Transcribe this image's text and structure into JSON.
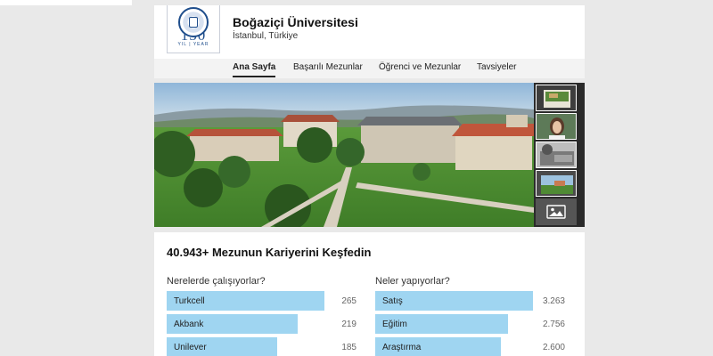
{
  "logo": {
    "number": "150",
    "sub": "YIL | YEAR"
  },
  "header": {
    "name": "Boğaziçi Üniversitesi",
    "location": "İstanbul, Türkiye"
  },
  "nav": {
    "items": [
      {
        "label": "Ana Sayfa",
        "active": true
      },
      {
        "label": "Başarılı Mezunlar",
        "active": false
      },
      {
        "label": "Öğrenci ve Mezunlar",
        "active": false
      },
      {
        "label": "Tavsiyeler",
        "active": false
      }
    ]
  },
  "media": {
    "thumbnail_icons": [
      "campus-photo-icon",
      "portrait-photo-icon",
      "historic-photo-icon",
      "landscape-photo-icon",
      "image-gallery-icon"
    ]
  },
  "stats": {
    "title": "40.943+ Mezunun Kariyerini Keşfedin",
    "where": {
      "title": "Nerelerde çalışıyorlar?",
      "items": [
        {
          "label": "Turkcell",
          "value": "265",
          "fill": 0.83
        },
        {
          "label": "Akbank",
          "value": "219",
          "fill": 0.69
        },
        {
          "label": "Unilever",
          "value": "185",
          "fill": 0.58
        }
      ]
    },
    "what": {
      "title": "Neler yapıyorlar?",
      "items": [
        {
          "label": "Satış",
          "value": "3.263",
          "fill": 0.83
        },
        {
          "label": "Eğitim",
          "value": "2.756",
          "fill": 0.7
        },
        {
          "label": "Araştırma",
          "value": "2.600",
          "fill": 0.66
        }
      ]
    }
  },
  "colors": {
    "bar": "#9fd5f1",
    "accent": "#1f4e8c"
  }
}
